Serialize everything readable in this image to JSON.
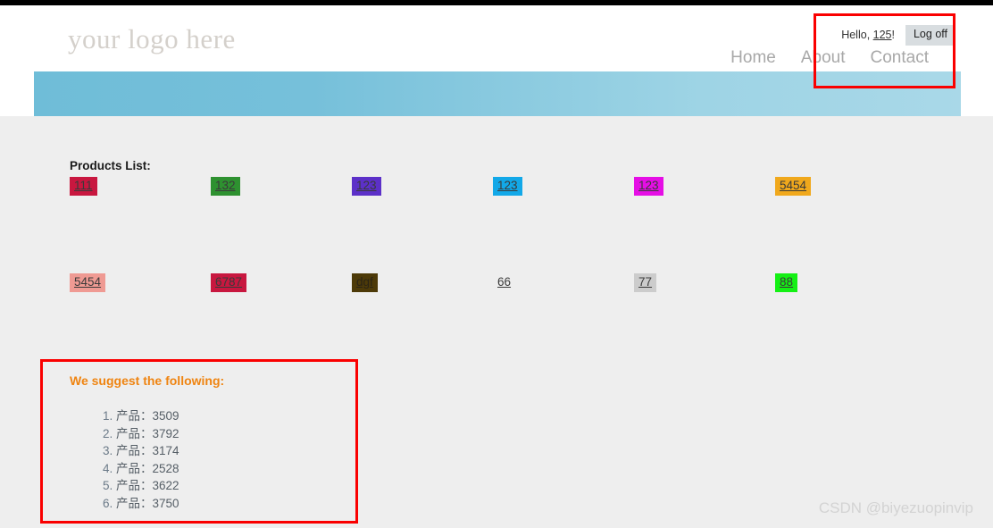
{
  "site": {
    "logo_text": "your logo here",
    "top_strip_color": "#000000",
    "banner_color": "#73bdd8",
    "page_background": "#eeeeee"
  },
  "login": {
    "greeting_prefix": "Hello, ",
    "username": "125",
    "greeting_suffix": "!",
    "logoff_label": "Log off"
  },
  "nav": {
    "items": [
      {
        "label": "Home"
      },
      {
        "label": "About"
      },
      {
        "label": "Contact"
      }
    ]
  },
  "products": {
    "title": "Products List:",
    "rows": [
      [
        {
          "label": "111",
          "bg": "#c8173f",
          "fg": "#3a3a3a"
        },
        {
          "label": "132",
          "bg": "#2e9130",
          "fg": "#3a3a3a"
        },
        {
          "label": "123",
          "bg": "#5c30c8",
          "fg": "#3a3a3a"
        },
        {
          "label": "123",
          "bg": "#12a8e8",
          "fg": "#3a3a3a"
        },
        {
          "label": "123",
          "bg": "#e50ee5",
          "fg": "#3a3a3a"
        },
        {
          "label": "5454",
          "bg": "#f0a81c",
          "fg": "#3a3a3a"
        }
      ],
      [
        {
          "label": "5454",
          "bg": "#ef9a93",
          "fg": "#3a3a3a"
        },
        {
          "label": "6787",
          "bg": "#c8173f",
          "fg": "#3a3a3a"
        },
        {
          "label": "dgf",
          "bg": "#4d3a08",
          "fg": "#2b2415"
        },
        {
          "label": "66",
          "bg": "transparent",
          "fg": "#3a3a3a"
        },
        {
          "label": "77",
          "bg": "#cccccc",
          "fg": "#3a3a3a"
        },
        {
          "label": "88",
          "bg": "#14f014",
          "fg": "#3a3a3a"
        }
      ]
    ]
  },
  "suggestions": {
    "heading": "We suggest the following:",
    "items": [
      "产品：3509",
      "产品：3792",
      "产品：3174",
      "产品：2528",
      "产品：3622",
      "产品：3750"
    ]
  },
  "annotations": {
    "color": "#fa0000",
    "boxes": [
      {
        "name": "login-area-highlight"
      },
      {
        "name": "suggestions-highlight"
      }
    ]
  },
  "watermark": {
    "text": "CSDN @biyezuopinvip"
  }
}
